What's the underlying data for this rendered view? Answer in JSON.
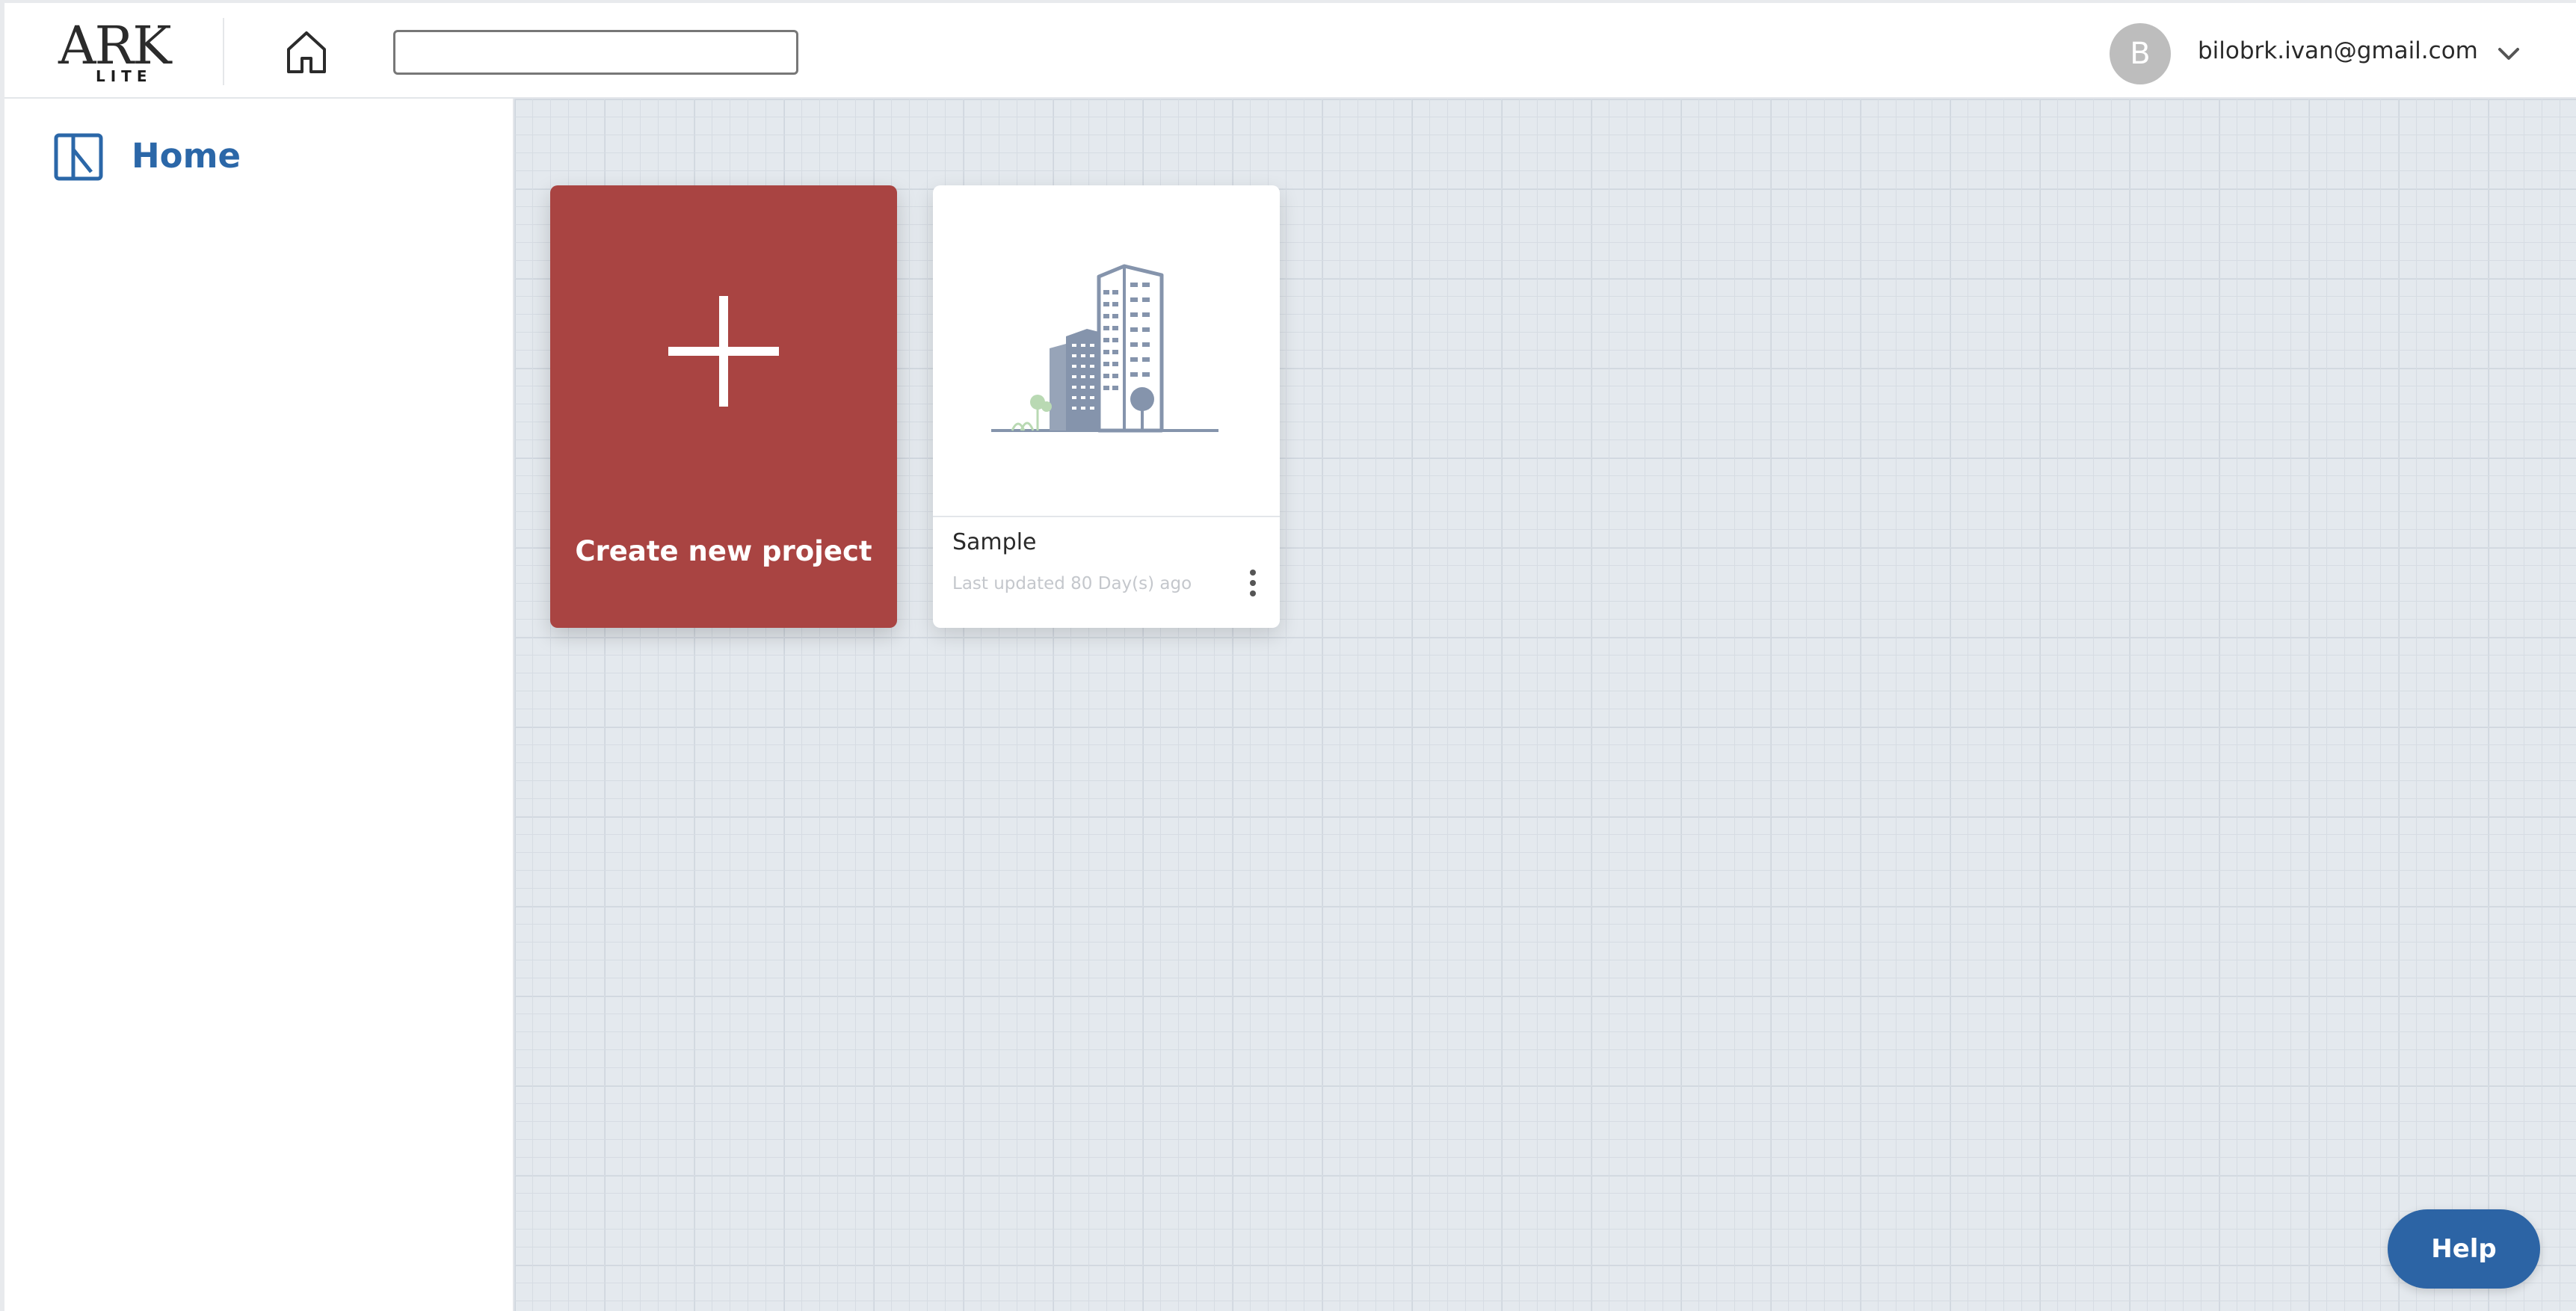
{
  "header": {
    "logo_text": "ARK",
    "logo_subtext": "LITE",
    "search_value": "",
    "search_placeholder": "",
    "user_initial": "B",
    "user_email": "bilobrk.ivan@gmail.com"
  },
  "sidebar": {
    "items": [
      {
        "label": "Home",
        "icon": "home-layout-icon",
        "active": true
      }
    ]
  },
  "main": {
    "create_card": {
      "label": "Create new project",
      "icon": "plus-icon"
    },
    "projects": [
      {
        "name": "Sample",
        "updated": "Last updated 80 Day(s) ago",
        "thumbnail": "building-illustration"
      }
    ]
  },
  "help_button": {
    "label": "Help"
  },
  "colors": {
    "accent_blue": "#2b67a8",
    "create_card_red": "#a94442",
    "canvas_bg": "#e4e9ee"
  }
}
